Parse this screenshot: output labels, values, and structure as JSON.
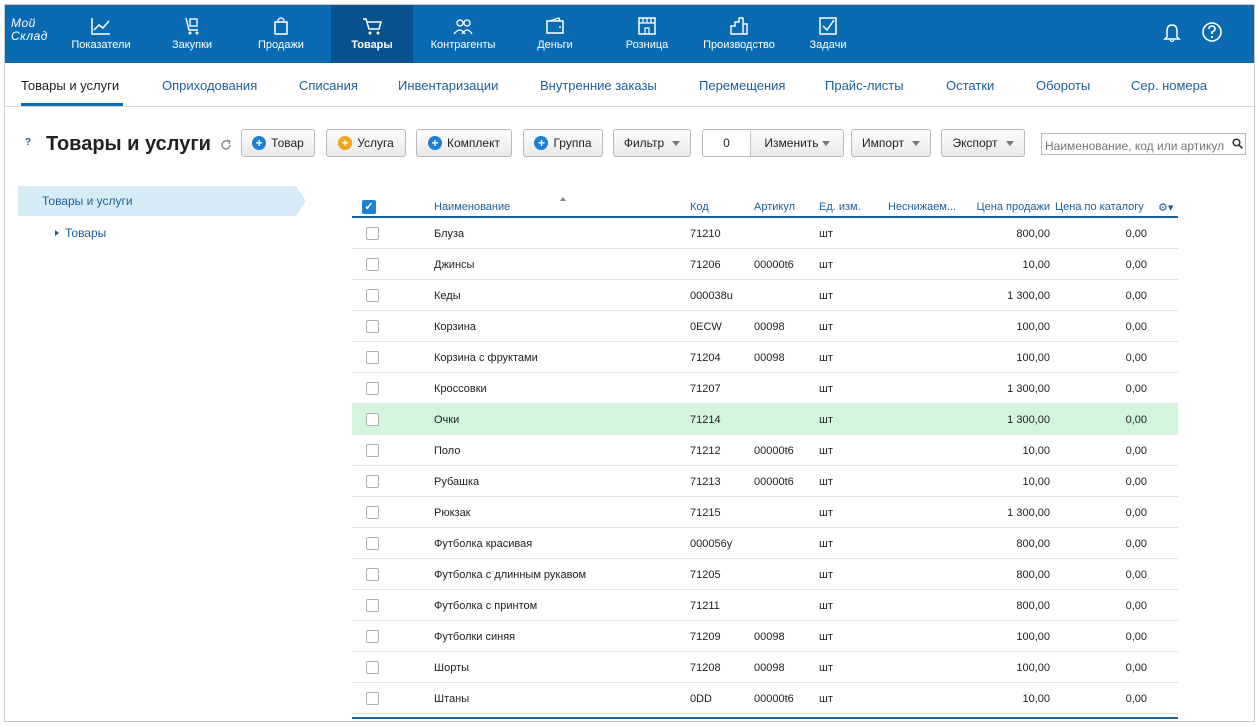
{
  "logo": {
    "line1": "Мой",
    "line2": "Склад"
  },
  "topnav": [
    {
      "label": "Показатели",
      "icon": "chart-icon"
    },
    {
      "label": "Закупки",
      "icon": "cart-hand-icon"
    },
    {
      "label": "Продажи",
      "icon": "bag-icon"
    },
    {
      "label": "Товары",
      "icon": "cart-icon",
      "active": true
    },
    {
      "label": "Контрагенты",
      "icon": "people-icon"
    },
    {
      "label": "Деньги",
      "icon": "wallet-icon"
    },
    {
      "label": "Розница",
      "icon": "store-icon"
    },
    {
      "label": "Производство",
      "icon": "factory-icon"
    },
    {
      "label": "Задачи",
      "icon": "checkbox-icon"
    }
  ],
  "subnav": [
    {
      "label": "Товары и услуги",
      "active": true
    },
    {
      "label": "Оприходования"
    },
    {
      "label": "Списания"
    },
    {
      "label": "Инвентаризации"
    },
    {
      "label": "Внутренние заказы"
    },
    {
      "label": "Перемещения"
    },
    {
      "label": "Прайс-листы"
    },
    {
      "label": "Остатки"
    },
    {
      "label": "Обороты"
    },
    {
      "label": "Сер. номера"
    }
  ],
  "toolbar": {
    "help": "?",
    "title": "Товары и услуги",
    "btn_product": "Товар",
    "btn_service": "Услуга",
    "btn_kit": "Комплект",
    "btn_group": "Группа",
    "btn_filter": "Фильтр",
    "selected_count": "0",
    "btn_change": "Изменить",
    "btn_import": "Импорт",
    "btn_export": "Экспорт",
    "search_placeholder": "Наименование, код или артикул"
  },
  "sidebar": {
    "root": "Товары и услуги",
    "child": "Товары"
  },
  "table": {
    "headers": {
      "name": "Наименование",
      "code": "Код",
      "article": "Артикул",
      "unit": "Ед. изм.",
      "min": "Неснижаем...",
      "price": "Цена продажи",
      "catalog": "Цена по каталогу"
    },
    "rows": [
      {
        "name": "Блуза",
        "code": "71210",
        "article": "",
        "unit": "шт",
        "price": "800,00",
        "catalog": "0,00"
      },
      {
        "name": "Джинсы",
        "code": "71206",
        "article": "00000t6",
        "unit": "шт",
        "price": "10,00",
        "catalog": "0,00"
      },
      {
        "name": "Кеды",
        "code": "000038u",
        "article": "",
        "unit": "шт",
        "price": "1 300,00",
        "catalog": "0,00"
      },
      {
        "name": "Корзина",
        "code": "0ECW",
        "article": "00098",
        "unit": "шт",
        "price": "100,00",
        "catalog": "0,00"
      },
      {
        "name": "Корзина с фруктами",
        "code": "71204",
        "article": "00098",
        "unit": "шт",
        "price": "100,00",
        "catalog": "0,00"
      },
      {
        "name": "Кроссовки",
        "code": "71207",
        "article": "",
        "unit": "шт",
        "price": "1 300,00",
        "catalog": "0,00"
      },
      {
        "name": "Очки",
        "code": "71214",
        "article": "",
        "unit": "шт",
        "price": "1 300,00",
        "catalog": "0,00",
        "highlight": true
      },
      {
        "name": "Поло",
        "code": "71212",
        "article": "00000t6",
        "unit": "шт",
        "price": "10,00",
        "catalog": "0,00"
      },
      {
        "name": "Рубашка",
        "code": "71213",
        "article": "00000t6",
        "unit": "шт",
        "price": "10,00",
        "catalog": "0,00"
      },
      {
        "name": "Рюкзак",
        "code": "71215",
        "article": "",
        "unit": "шт",
        "price": "1 300,00",
        "catalog": "0,00"
      },
      {
        "name": "Футболка красивая",
        "code": "000056y",
        "article": "",
        "unit": "шт",
        "price": "800,00",
        "catalog": "0,00"
      },
      {
        "name": "Футболка с длинным рукавом",
        "code": "71205",
        "article": "",
        "unit": "шт",
        "price": "800,00",
        "catalog": "0,00"
      },
      {
        "name": "Футболка с принтом",
        "code": "71211",
        "article": "",
        "unit": "шт",
        "price": "800,00",
        "catalog": "0,00"
      },
      {
        "name": "Футболки синяя",
        "code": "71209",
        "article": "00098",
        "unit": "шт",
        "price": "100,00",
        "catalog": "0,00"
      },
      {
        "name": "Шорты",
        "code": "71208",
        "article": "00098",
        "unit": "шт",
        "price": "100,00",
        "catalog": "0,00"
      },
      {
        "name": "Штаны",
        "code": "0DD",
        "article": "00000t6",
        "unit": "шт",
        "price": "10,00",
        "catalog": "0,00"
      }
    ]
  },
  "colors": {
    "topbar": "#0a6bb3",
    "topbar_active": "#08528f",
    "link": "#1d5f99",
    "highlight_row": "#d4f4dc"
  }
}
